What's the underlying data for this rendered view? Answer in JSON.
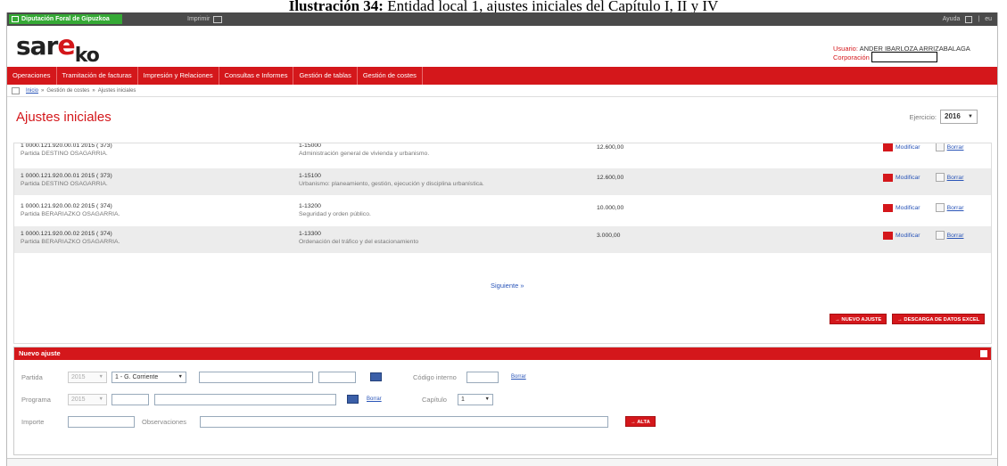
{
  "document": {
    "heading_bold": "Ilustración 34:",
    "heading_text": "Entidad local 1, ajustes iniciales del Capítulo I, II y IV"
  },
  "topbar": {
    "org": "Diputación Foral de Gipuzkoa",
    "print": "Imprimir",
    "help": "Ayuda",
    "lang": "eu"
  },
  "logo": {
    "part1": "sar",
    "part2": "e",
    "part3": "ko"
  },
  "user": {
    "label": "Usuario:",
    "name": "ANDER IBARLOZA ARRIZABALAGA",
    "corp_label": "Corporación"
  },
  "nav": {
    "items": [
      "Operaciones",
      "Tramitación de facturas",
      "Impresión y Relaciones",
      "Consultas e Informes",
      "Gestión de tablas",
      "Gestión de costes"
    ]
  },
  "breadcrumb": {
    "home": "Inicio",
    "sep": "»",
    "level1": "Gestión de costes",
    "level2": "Ajustes iniciales"
  },
  "page": {
    "title": "Ajustes iniciales",
    "ejercicio_label": "Ejercicio:",
    "ejercicio_value": "2016"
  },
  "rows": [
    {
      "partida": "1 0000.121.920.00.01 2015 ( 373)",
      "partida_name": "Partida DESTINO OSAGARRIA.",
      "programa": "1-15000",
      "programa_desc": "Administración general de vivienda y urbanismo.",
      "importe": "12.600,00",
      "modify": "Modificar",
      "delete": "Borrar"
    },
    {
      "partida": "1 0000.121.920.00.01 2015 ( 373)",
      "partida_name": "Partida DESTINO OSAGARRIA.",
      "programa": "1-15100",
      "programa_desc": "Urbanismo: planeamiento, gestión, ejecución y disciplina urbanística.",
      "importe": "12.600,00",
      "modify": "Modificar",
      "delete": "Borrar"
    },
    {
      "partida": "1 0000.121.920.00.02 2015 ( 374)",
      "partida_name": "Partida BERARIAZKO OSAGARRIA.",
      "programa": "1-13200",
      "programa_desc": "Seguridad y orden público.",
      "importe": "10.000,00",
      "modify": "Modificar",
      "delete": "Borrar"
    },
    {
      "partida": "1 0000.121.920.00.02 2015 ( 374)",
      "partida_name": "Partida BERARIAZKO OSAGARRIA.",
      "programa": "1-13300",
      "programa_desc": "Ordenación del tráfico y del estacionamiento",
      "importe": "3.000,00",
      "modify": "Modificar",
      "delete": "Borrar"
    }
  ],
  "pagination": {
    "next": "Siguiente »"
  },
  "actions": {
    "new_adjust": "→ NUEVO AJUSTE",
    "download_excel": "→ DESCARGA DE DATOS EXCEL"
  },
  "form": {
    "title": "Nuevo ajuste",
    "partida_label": "Partida",
    "partida_year": "2015",
    "partida_type": "1 - G. Corriente",
    "codigo_label": "Código interno",
    "borrar": "Borrar",
    "programa_label": "Programa",
    "programa_year": "2015",
    "capitulo_label": "Capítulo",
    "capitulo_value": "1",
    "importe_label": "Importe",
    "observaciones_label": "Observaciones",
    "alta": "→ ALTA"
  },
  "colors": {
    "brand_red": "#d4171b",
    "link_blue": "#2a55b8",
    "gov_green": "#35a935"
  }
}
